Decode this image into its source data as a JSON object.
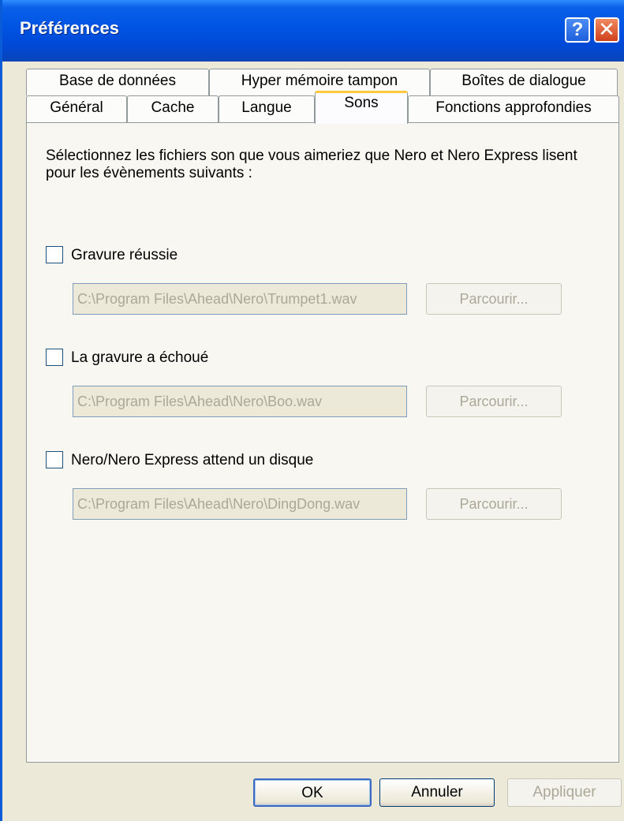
{
  "window": {
    "title": "Préférences"
  },
  "tabs_row1": [
    "Base de données",
    "Hyper mémoire tampon",
    "Boîtes de dialogue"
  ],
  "tabs_row2": [
    "Général",
    "Cache",
    "Langue",
    "Sons",
    "Fonctions approfondies"
  ],
  "active_tab": "Sons",
  "sons": {
    "description": "Sélectionnez les fichiers son que vous aimeriez que Nero et Nero Express lisent pour les évènements suivants :",
    "events": [
      {
        "label": "Gravure réussie",
        "checked": false,
        "path": "C:\\Program Files\\Ahead\\Nero\\Trumpet1.wav",
        "browse": "Parcourir..."
      },
      {
        "label": "La gravure a échoué",
        "checked": false,
        "path": "C:\\Program Files\\Ahead\\Nero\\Boo.wav",
        "browse": "Parcourir..."
      },
      {
        "label": "Nero/Nero Express attend un disque",
        "checked": false,
        "path": "C:\\Program Files\\Ahead\\Nero\\DingDong.wav",
        "browse": "Parcourir..."
      }
    ]
  },
  "buttons": {
    "ok": "OK",
    "cancel": "Annuler",
    "apply": "Appliquer"
  }
}
